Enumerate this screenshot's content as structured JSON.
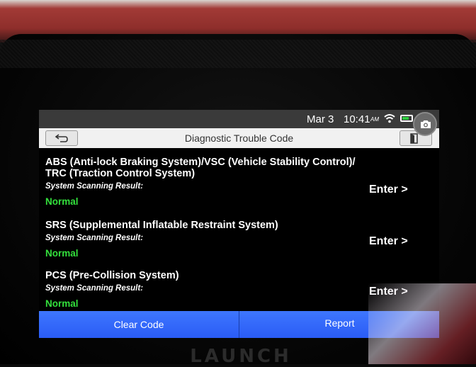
{
  "status_bar": {
    "date": "Mar 3",
    "time": "10:41",
    "ampm": "AM"
  },
  "header": {
    "title": "Diagnostic Trouble Code"
  },
  "systems": [
    {
      "name": "ABS (Anti-lock Braking System)/VSC (Vehicle Stability Control)/ TRC (Traction Control System)",
      "caption": "System Scanning Result:",
      "status": "Normal",
      "action": "Enter >"
    },
    {
      "name": "SRS (Supplemental Inflatable Restraint System)",
      "caption": "System Scanning Result:",
      "status": "Normal",
      "action": "Enter >"
    },
    {
      "name": "PCS (Pre-Collision System)",
      "caption": "System Scanning Result:",
      "status": "Normal",
      "action": "Enter >"
    }
  ],
  "footer": {
    "clear_label": "Clear Code",
    "report_label": "Report"
  },
  "device": {
    "brand": "LAUNCH"
  },
  "colors": {
    "status_ok": "#33e03c",
    "action_bar": "#2a5cf5",
    "housing": "#8e2e2b"
  },
  "icons": [
    "back-arrow-icon",
    "wifi-icon",
    "battery-icon",
    "exit-icon",
    "camera-icon"
  ]
}
